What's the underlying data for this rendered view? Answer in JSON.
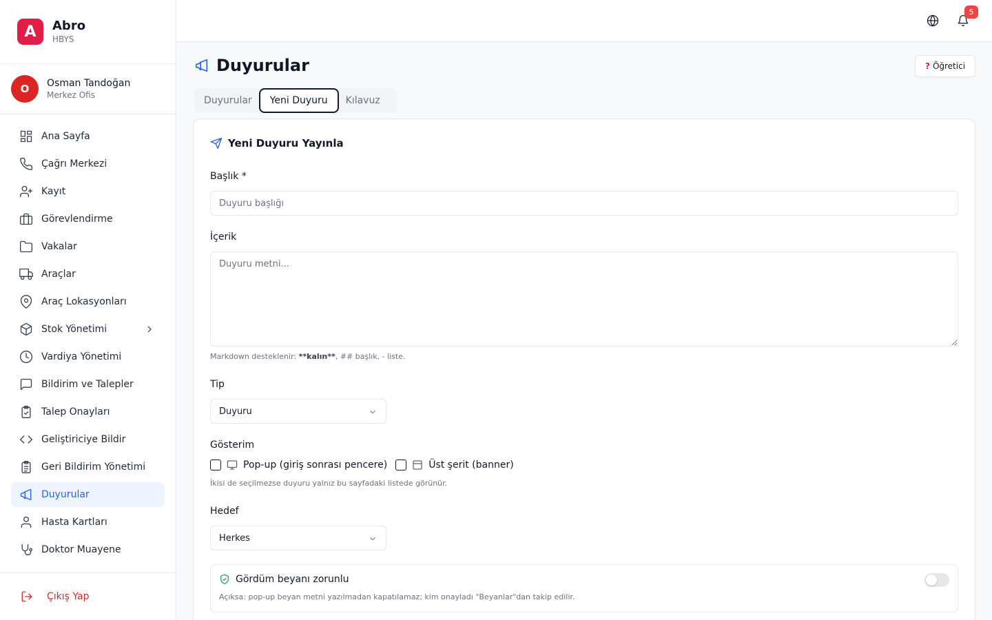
{
  "brand": {
    "logo_letter": "A",
    "name": "Abro",
    "subtitle": "HBYS",
    "color": "#e11d48"
  },
  "user": {
    "initial": "O",
    "name": "Osman Tandoğan",
    "office": "Merkez Ofis"
  },
  "sidebar": {
    "items": [
      {
        "label": "Ana Sayfa",
        "icon": "dashboard-icon"
      },
      {
        "label": "Çağrı Merkezi",
        "icon": "phone-icon"
      },
      {
        "label": "Kayıt",
        "icon": "user-plus-icon"
      },
      {
        "label": "Görevlendirme",
        "icon": "briefcase-icon"
      },
      {
        "label": "Vakalar",
        "icon": "folder-icon"
      },
      {
        "label": "Araçlar",
        "icon": "truck-icon"
      },
      {
        "label": "Araç Lokasyonları",
        "icon": "map-pin-icon"
      },
      {
        "label": "Stok Yönetimi",
        "icon": "package-icon"
      },
      {
        "label": "Vardiya Yönetimi",
        "icon": "clock-icon"
      },
      {
        "label": "Bildirim ve Talepler",
        "icon": "message-square-icon"
      },
      {
        "label": "Talep Onayları",
        "icon": "clipboard-check-icon"
      },
      {
        "label": "Geliştiriciye Bildir",
        "icon": "code-icon"
      },
      {
        "label": "Geri Bildirim Yönetimi",
        "icon": "clipboard-list-icon"
      },
      {
        "label": "Duyurular",
        "icon": "megaphone-icon"
      },
      {
        "label": "Hasta Kartları",
        "icon": "user-icon"
      },
      {
        "label": "Doktor Muayene",
        "icon": "stethoscope-icon"
      }
    ],
    "active_index": 13,
    "logout_label": "Çıkış Yap"
  },
  "topbar": {
    "notification_count": "5"
  },
  "page": {
    "title": "Duyurular",
    "tutor_label": "Öğretici",
    "tabs": [
      {
        "label": "Duyurular"
      },
      {
        "label": "Yeni Duyuru"
      },
      {
        "label": "Kılavuz"
      }
    ],
    "active_tab": 1
  },
  "form": {
    "heading": "Yeni Duyuru Yayınla",
    "title_label": "Başlık *",
    "title_placeholder": "Duyuru başlığı",
    "title_value": "",
    "content_label": "İçerik",
    "content_placeholder": "Duyuru metni...",
    "markdown_hint_prefix": "Markdown desteklenir: ",
    "markdown_hint_bold": "**kalın**",
    "markdown_hint_suffix": ", ## başlık, - liste.",
    "type_label": "Tip",
    "type_value": "Duyuru",
    "display_label": "Gösterim",
    "popup_label": "Pop-up (giriş sonrası pencere)",
    "popup_checked": false,
    "banner_label": "Üst şerit (banner)",
    "banner_checked": false,
    "display_hint": "İkisi de seçilmezse duyuru yalnız bu sayfadaki listede görünür.",
    "target_label": "Hedef",
    "target_value": "Herkes",
    "confirm_title": "Gördüm beyanı zorunlu",
    "confirm_desc": "Açıksa: pop-up beyan metni yazılmadan kapatılamaz; kim onayladı \"Beyanlar\"dan takip edilir.",
    "confirm_enabled": false
  },
  "colors": {
    "accent": "#2563eb",
    "danger": "#dc2626",
    "success": "#16a34a"
  }
}
